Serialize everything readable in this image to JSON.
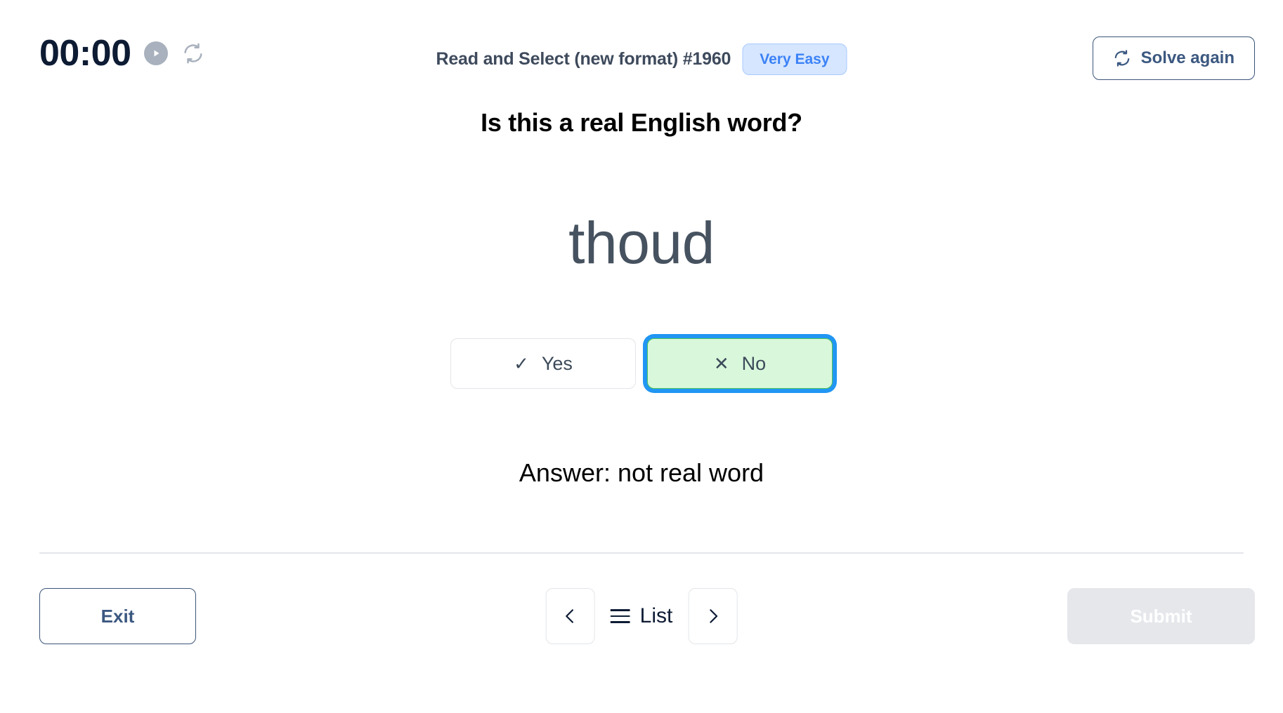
{
  "header": {
    "timer": "00:00",
    "play_icon": "play-icon",
    "reset_icon": "reset-icon",
    "exercise_title": "Read and Select (new format) #1960",
    "difficulty_label": "Very Easy",
    "solve_again_label": "Solve again",
    "solve_again_icon": "refresh-icon"
  },
  "main": {
    "question": "Is this a real English word?",
    "word": "thoud",
    "choices": [
      {
        "label": "Yes",
        "glyph": "✓",
        "icon_name": "check-icon",
        "selected": false
      },
      {
        "label": "No",
        "glyph": "✕",
        "icon_name": "cross-icon",
        "selected": true
      }
    ],
    "answer": "Answer: not real word"
  },
  "footer": {
    "exit_label": "Exit",
    "prev_icon": "chevron-left-icon",
    "list_label": "List",
    "list_icon": "hamburger-icon",
    "next_icon": "chevron-right-icon",
    "submit_label": "Submit"
  },
  "colors": {
    "accent_blue": "#3b82f6",
    "focus_ring": "#2196f3",
    "selected_green_bg": "#d9f7db",
    "selected_green_border": "#4cc45a",
    "navy": "#0d1b33",
    "slate": "#46525f",
    "disabled_gray": "#e5e7eb",
    "border_gray": "#e2e5e9",
    "outline_navy": "#3a5478"
  }
}
